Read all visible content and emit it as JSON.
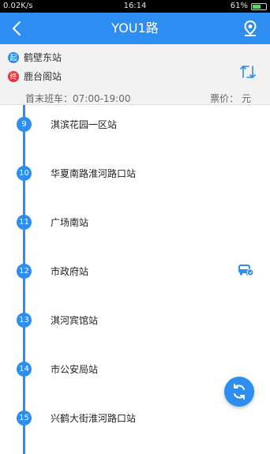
{
  "status_bar": {
    "network": "0.02K/s",
    "time": "16:14",
    "battery": "61%",
    "battery_level": 0.61
  },
  "app_bar": {
    "title": "YOU1路"
  },
  "route": {
    "start_badge": "起",
    "start_stop": "鹤壁东站",
    "end_badge": "终",
    "end_stop": "鹿台阁站",
    "hours_label": "首末班车：07:00-19:00",
    "fare_label": "票价：  元"
  },
  "stops": [
    {
      "num": "9",
      "name": "淇滨花园一区站"
    },
    {
      "num": "10",
      "name": "华夏南路淮河路口站"
    },
    {
      "num": "11",
      "name": "广场南站"
    },
    {
      "num": "12",
      "name": "市政府站"
    },
    {
      "num": "13",
      "name": "淇河宾馆站"
    },
    {
      "num": "14",
      "name": "市公安局站"
    },
    {
      "num": "15",
      "name": "兴鹤大街淮河路口站"
    }
  ],
  "colors": {
    "primary": "#2d8df0",
    "start_badge": "#2d8df0",
    "end_badge": "#e8333a"
  },
  "icons": {
    "back": "chevron-left-icon",
    "location": "location-pin-icon",
    "swap": "swap-direction-icon",
    "bus": "bus-icon",
    "refresh": "refresh-icon"
  }
}
